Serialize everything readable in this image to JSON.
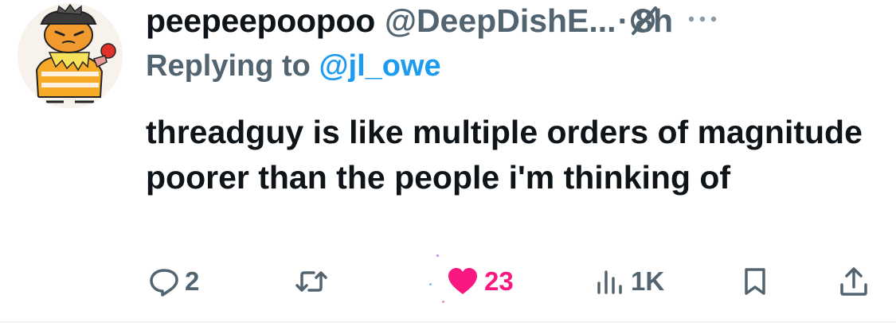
{
  "tweet": {
    "display_name": "peepeepoopoo",
    "handle": "@DeepDishE...",
    "separator": "·",
    "time": "8h",
    "replying_prefix": "Replying to ",
    "replying_to": "@jl_owe",
    "text": "threadguy is like multiple orders of magnitude poorer than the people i'm thinking of"
  },
  "actions": {
    "reply_count": "2",
    "repost_count": "",
    "like_count": "23",
    "views_count": "1K"
  },
  "colors": {
    "text": "#0f1419",
    "secondary": "#536471",
    "link": "#1d9bf0",
    "like": "#f91880"
  },
  "icons": [
    "avatar",
    "grok-icon",
    "more-icon",
    "reply-icon",
    "repost-icon",
    "like-icon",
    "views-icon",
    "bookmark-icon",
    "share-icon"
  ]
}
